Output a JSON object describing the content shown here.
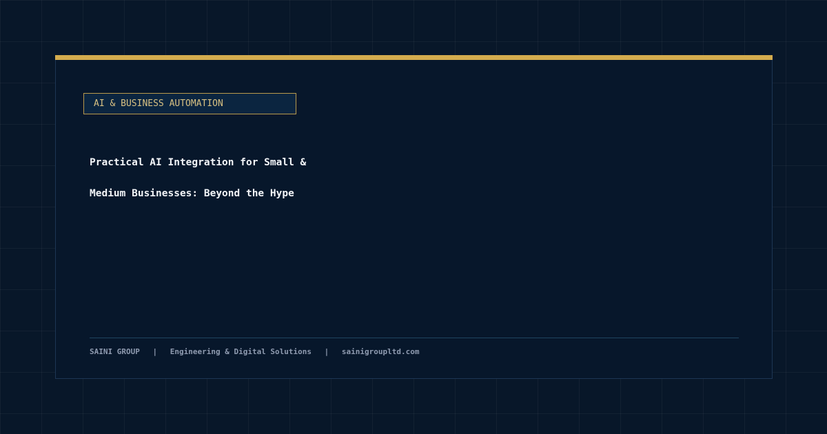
{
  "card": {
    "tag": "AI & BUSINESS AUTOMATION",
    "headline_lines": [
      "Practical AI Integration for Small &",
      "Medium Businesses: Beyond the Hype"
    ]
  },
  "footer": {
    "company": "SAINI GROUP",
    "separator": "|",
    "tagline": "Engineering & Digital Solutions",
    "website": "sainigroupltd.com"
  },
  "colors": {
    "background": "#081729",
    "card": "#07172b",
    "accent": "#d4ac4e",
    "headline": "#f3f5f8",
    "footer_text": "#8f9bb0"
  }
}
